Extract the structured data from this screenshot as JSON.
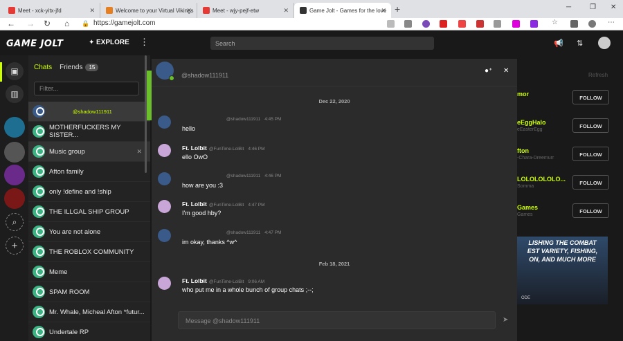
{
  "browser": {
    "tabs": [
      {
        "label": "Meet - xck-yitx-jfd",
        "color": "#e53935"
      },
      {
        "label": "Welcome to your Virtual Vikings",
        "color": "#e67e22"
      },
      {
        "label": "Meet - wjy-pejf-etw",
        "color": "#e53935"
      },
      {
        "label": "Game Jolt - Games for the love",
        "color": "#333333"
      }
    ],
    "new_tab": "+",
    "url": "https://gamejolt.com"
  },
  "topnav": {
    "logo": "GAME JOLT",
    "explore": "EXPLORE",
    "search_placeholder": "Search"
  },
  "chats": {
    "tab_chats": "Chats",
    "tab_friends": "Friends",
    "friends_count": "15",
    "filter_placeholder": "Filter...",
    "rooms": [
      {
        "label": "@shadow111911",
        "type": "user"
      },
      {
        "label": "MOTHERFUCKERS MY SISTER..."
      },
      {
        "label": "Music group"
      },
      {
        "label": "Afton family"
      },
      {
        "label": "only !define and !ship"
      },
      {
        "label": "THE ILLGAL SHIP GROUP"
      },
      {
        "label": "You are not alone"
      },
      {
        "label": "THE ROBLOX COMMUNITY"
      },
      {
        "label": "Meme"
      },
      {
        "label": "SPAM ROOM"
      },
      {
        "label": "Mr. Whale, Micheal Afton *futur..."
      },
      {
        "label": "Undertale RP"
      }
    ]
  },
  "conversation": {
    "header_user": "@shadow111911",
    "dates": [
      "Dec 22, 2020",
      "Feb 18, 2021"
    ],
    "messages": [
      {
        "name": "",
        "user": "@shadow111911",
        "time": "4:45 PM",
        "text": "hello"
      },
      {
        "name": "Ft. Lolbit",
        "user": "@FunTime-LolBit",
        "time": "4:46 PM",
        "text": "ello OwO"
      },
      {
        "name": "",
        "user": "@shadow111911",
        "time": "4:46 PM",
        "text": "how are you :3"
      },
      {
        "name": "Ft. Lolbit",
        "user": "@FunTime-LolBit",
        "time": "4:47 PM",
        "text": "I'm good hby?"
      },
      {
        "name": "",
        "user": "@shadow111911",
        "time": "4:47 PM",
        "text": "im okay, thanks ^w^"
      },
      {
        "name": "Ft. Lolbit",
        "user": "@FunTime-LolBit",
        "time": "9:06 AM",
        "text": "who put me in a whole bunch of group chats ;--;"
      }
    ],
    "composer_placeholder": "Message @shadow111911"
  },
  "right": {
    "refresh": "Refresh",
    "follow_label": "FOLLOW",
    "suggestions": [
      {
        "name": "mor",
        "sub": ""
      },
      {
        "name": "eEggHalo",
        "sub": "eEasterEgg"
      },
      {
        "name": "fton",
        "sub": "-Chara-Dreemurr"
      },
      {
        "name": "LOLOLOLOLO...",
        "sub": "Somma"
      },
      {
        "name": "Games",
        "sub": "Games"
      }
    ],
    "banner_lines": [
      "LISHING THE COMBAT",
      "EST VARIETY, FISHING,",
      "ON, AND MUCH MORE"
    ],
    "banner_footer": "ODE"
  }
}
